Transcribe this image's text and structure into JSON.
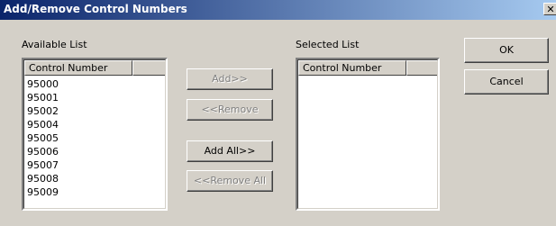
{
  "dialog": {
    "title": "Add/Remove Control Numbers",
    "close_glyph": "✕"
  },
  "available": {
    "label": "Available List",
    "column": "Control Number",
    "items": [
      "95000",
      "95001",
      "95002",
      "95004",
      "95005",
      "95006",
      "95007",
      "95008",
      "95009"
    ]
  },
  "selected": {
    "label": "Selected List",
    "column": "Control Number",
    "items": []
  },
  "buttons": {
    "add": "Add>>",
    "remove": "<<Remove",
    "add_all": "Add All>>",
    "remove_all": "<<Remove All",
    "ok": "OK",
    "cancel": "Cancel"
  }
}
